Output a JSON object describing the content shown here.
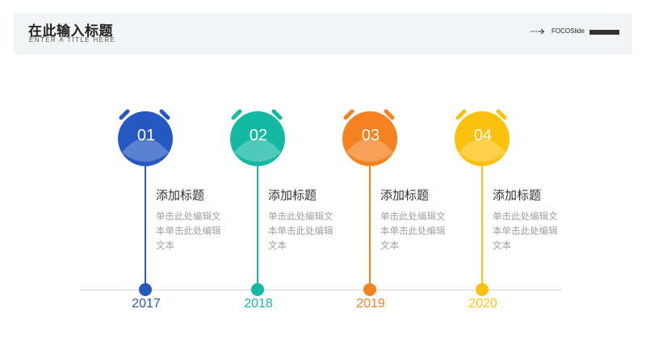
{
  "header": {
    "title": "在此输入标题",
    "subtitle": "ENTER A TITLE HERE",
    "brand": "FOCOSlide"
  },
  "colors": {
    "blue": "#2558c0",
    "teal": "#14b9a3",
    "orange": "#f58220",
    "yellow": "#fbc10d"
  },
  "items": [
    {
      "number": "01",
      "year": "2017",
      "title": "添加标题",
      "text": "单击此处编辑文本单击此处编辑文本",
      "color": "#2558c0"
    },
    {
      "number": "02",
      "year": "2018",
      "title": "添加标题",
      "text": "单击此处编辑文本单击此处编辑文本",
      "color": "#14b9a3"
    },
    {
      "number": "03",
      "year": "2019",
      "title": "添加标题",
      "text": "单击此处编辑文本单击此处编辑文本",
      "color": "#f58220"
    },
    {
      "number": "04",
      "year": "2020",
      "title": "添加标题",
      "text": "单击此处编辑文本单击此处编辑文本",
      "color": "#fbc10d"
    }
  ]
}
